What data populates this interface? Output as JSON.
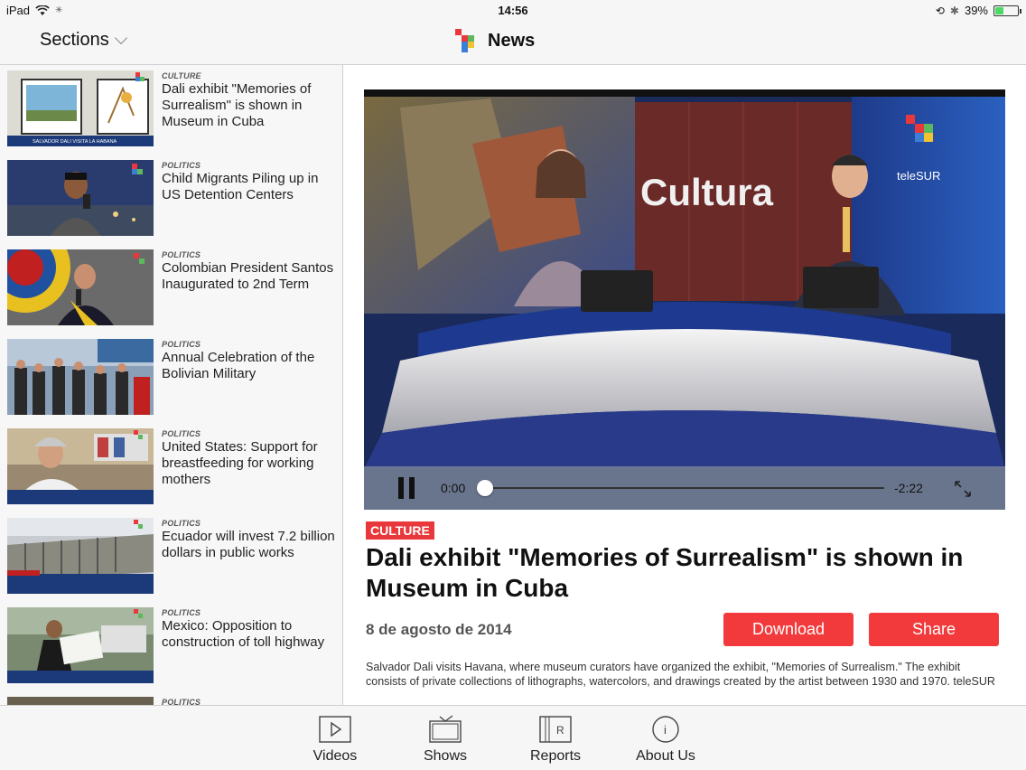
{
  "status_bar": {
    "device": "iPad",
    "time": "14:56",
    "battery_percent": "39%",
    "battery_level": 0.39
  },
  "nav": {
    "sections_label": "Sections",
    "title": "News"
  },
  "brand_colors": {
    "red": "#e8383b",
    "green": "#5cb85c",
    "blue": "#3a7fd5",
    "yellow": "#f2c230"
  },
  "list": [
    {
      "category": "CULTURE",
      "title": "Dali exhibit \"Memories of Surrealism\" is shown in Museum in Cuba",
      "caption": "SALVADOR DALI VISITA LA HABANA"
    },
    {
      "category": "POLITICS",
      "title": "Child Migrants Piling up in US Detention Centers"
    },
    {
      "category": "POLITICS",
      "title": "Colombian President Santos Inaugurated to 2nd Term"
    },
    {
      "category": "POLITICS",
      "title": "Annual Celebration of the Bolivian Military"
    },
    {
      "category": "POLITICS",
      "title": "United States: Support for breastfeeding for working mothers"
    },
    {
      "category": "POLITICS",
      "title": "Ecuador will invest 7.2 billion dollars in public works"
    },
    {
      "category": "POLITICS",
      "title": "Mexico: Opposition to construction of toll highway"
    },
    {
      "category": "POLITICS",
      "title": ""
    }
  ],
  "video": {
    "set_text": "Cultura",
    "channel": "teleSUR",
    "current_time": "0:00",
    "remaining_time": "-2:22",
    "progress": 0.0
  },
  "article": {
    "category": "CULTURE",
    "headline": "Dali exhibit \"Memories of Surrealism\" is shown in Museum in Cuba",
    "date": "8 de agosto de 2014",
    "download_label": "Download",
    "share_label": "Share",
    "description": "Salvador Dali visits Havana, where museum curators have organized the exhibit, \"Memories of Surrealism.\" The exhibit consists of private collections of lithographs, watercolors, and drawings created by the artist between 1930 and 1970. teleSUR"
  },
  "tabs": [
    {
      "label": "Videos",
      "icon": "play-icon"
    },
    {
      "label": "Shows",
      "icon": "tv-icon"
    },
    {
      "label": "Reports",
      "icon": "reports-icon"
    },
    {
      "label": "About Us",
      "icon": "info-icon"
    }
  ]
}
